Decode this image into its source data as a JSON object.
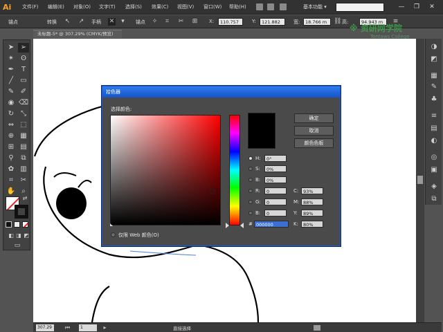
{
  "app": {
    "logo": "Ai",
    "workspace": "基本功能 ▾"
  },
  "menu": [
    "文件(F)",
    "编辑(E)",
    "对象(O)",
    "文字(T)",
    "选择(S)",
    "效果(C)",
    "视图(V)",
    "窗口(W)",
    "帮助(H)"
  ],
  "window_buttons": [
    "—",
    "❐",
    "✕"
  ],
  "control_bar": {
    "anchor_label": "锚点",
    "convert_label": "转换",
    "handle_label": "手柄",
    "anchor2_label": "锚点",
    "x_label": "X:",
    "x_value": "110.757",
    "y_label": "Y:",
    "y_value": "121.882",
    "w_label": "宽:",
    "w_value": "18.766 m",
    "h_label": "高:",
    "h_value": "94.943 m"
  },
  "document_tab": "未标题-5* @ 307.29% (CMYK/预览)",
  "watermark": {
    "main": "※ 资研网学院",
    "sub": "Tontaws College"
  },
  "status_bar": {
    "zoom": "307.29",
    "artboard": "1",
    "mode": "直接选择"
  },
  "dialog": {
    "title": "拾色器",
    "select_label": "选择颜色:",
    "buttons": {
      "ok": "确定",
      "cancel": "取消",
      "swatches": "颜色色板"
    },
    "hsb": [
      {
        "label": "H:",
        "value": "0°"
      },
      {
        "label": "S:",
        "value": "0%"
      },
      {
        "label": "B:",
        "value": "0%"
      }
    ],
    "rgb": [
      {
        "label": "R:",
        "value": "0"
      },
      {
        "label": "G:",
        "value": "0"
      },
      {
        "label": "B:",
        "value": "0"
      }
    ],
    "cmyk": [
      {
        "label": "C:",
        "value": "93%"
      },
      {
        "label": "M:",
        "value": "88%"
      },
      {
        "label": "Y:",
        "value": "89%"
      },
      {
        "label": "K:",
        "value": "80%"
      }
    ],
    "hex_label": "#",
    "hex_value": "000000",
    "web_only_label": "仅限 Web 颜色(O)"
  },
  "colors": {
    "accent_title": "#1e62d8",
    "selected_color": "#000000"
  }
}
